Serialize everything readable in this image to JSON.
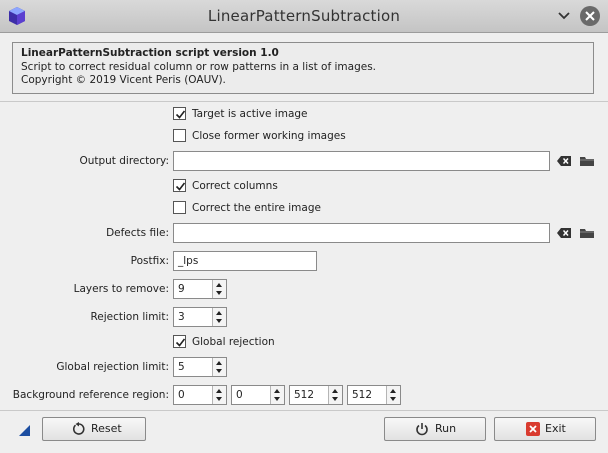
{
  "window": {
    "title": "LinearPatternSubtraction"
  },
  "info": {
    "heading": "LinearPatternSubtraction script version 1.0",
    "line1": "Script to correct residual column or row patterns in a list of images.",
    "line2": "Copyright © 2019 Vicent Peris (OAUV)."
  },
  "options": {
    "target_active": {
      "label": "Target is active image",
      "checked": true
    },
    "close_former": {
      "label": "Close former working images",
      "checked": false
    },
    "output_dir": {
      "label": "Output directory:",
      "value": ""
    },
    "correct_columns": {
      "label": "Correct columns",
      "checked": true
    },
    "correct_entire": {
      "label": "Correct the entire image",
      "checked": false
    },
    "defects_file": {
      "label": "Defects file:",
      "value": ""
    },
    "postfix": {
      "label": "Postfix:",
      "value": "_lps"
    },
    "layers": {
      "label": "Layers to remove:",
      "value": "9"
    },
    "rejection": {
      "label": "Rejection limit:",
      "value": "3"
    },
    "global_rejection": {
      "label": "Global rejection",
      "checked": true
    },
    "global_limit": {
      "label": "Global rejection limit:",
      "value": "5"
    },
    "bg_region": {
      "label": "Background reference region:",
      "values": [
        "0",
        "0",
        "512",
        "512"
      ]
    }
  },
  "buttons": {
    "reset": "Reset",
    "run": "Run",
    "exit": "Exit"
  },
  "icons": [
    "app-icon",
    "minimize-icon",
    "close-icon",
    "clear-icon",
    "folder-icon",
    "reset-icon",
    "power-icon",
    "exit-icon",
    "resize-corner-icon"
  ],
  "colors": {
    "accent": "#1c4ea1",
    "exit_red": "#d93b2f"
  }
}
